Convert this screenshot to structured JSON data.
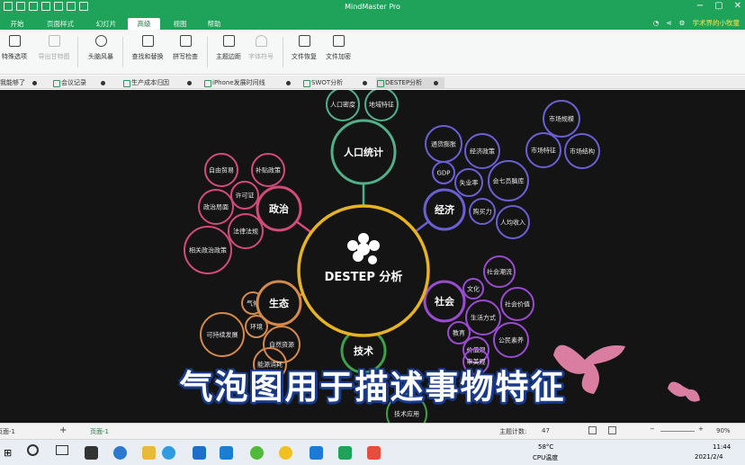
{
  "window": {
    "title": "MindMaster Pro",
    "user": "学术界的小牧童"
  },
  "menu": {
    "tabs": [
      "开始",
      "页面样式",
      "幻灯片",
      "高级",
      "视图",
      "帮助"
    ],
    "active": 3
  },
  "ribbon": {
    "buttons": [
      {
        "label": "特殊选项",
        "disabled": false
      },
      {
        "label": "导出甘特图",
        "disabled": true
      },
      {
        "label": "头脑风暴",
        "disabled": false
      },
      {
        "label": "查找和替换",
        "disabled": false
      },
      {
        "label": "拼写检查",
        "disabled": false
      },
      {
        "label": "主题边距",
        "disabled": false
      },
      {
        "label": "字体符号",
        "disabled": true
      },
      {
        "label": "文件恢复",
        "disabled": false
      },
      {
        "label": "文件加密",
        "disabled": false
      }
    ]
  },
  "doc_tabs": [
    "我能够了",
    "会议记录",
    "生产成本归因",
    "iPhone发展时间线",
    "SWOT分析",
    "DESTEP分析"
  ],
  "mindmap": {
    "center": "DESTEP 分析",
    "branches": [
      {
        "name": "人口统计",
        "color": "#4fb08a",
        "children": [
          "人口密度",
          "地域特征"
        ]
      },
      {
        "name": "经济",
        "color": "#6a5fd4",
        "children": [
          "通货膨胀",
          "经济政策",
          "GDP",
          "失业率",
          "会七员脑库",
          "购买力",
          "人均收入",
          "市场规模",
          "市场特征",
          "市场结构"
        ]
      },
      {
        "name": "社会",
        "color": "#9a4bd0",
        "children": [
          "社会潮流",
          "文化",
          "社会价值",
          "生活方式",
          "教育",
          "公民素养",
          "价值观",
          "审美观"
        ]
      },
      {
        "name": "技术",
        "color": "#3fa04a",
        "children": [
          "技术应用"
        ]
      },
      {
        "name": "生态",
        "color": "#d5894a",
        "children": [
          "气候",
          "环境",
          "可持续发展",
          "自然资源",
          "能源消耗"
        ]
      },
      {
        "name": "政治",
        "color": "#d24b7a",
        "children": [
          "自由贸易",
          "补贴政策",
          "许可证",
          "政治局面",
          "法律法规",
          "相关政治政策"
        ]
      }
    ]
  },
  "subtitle": "气泡图用于描述事物特征",
  "status": {
    "page": "页面-1",
    "topic_count_label": "主题计数:",
    "topic_count": "47",
    "zoom": "90%"
  },
  "taskbar": {
    "temp": "58°C",
    "temp_label": "CPU温度",
    "time": "11:44",
    "date": "2021/2/4"
  }
}
